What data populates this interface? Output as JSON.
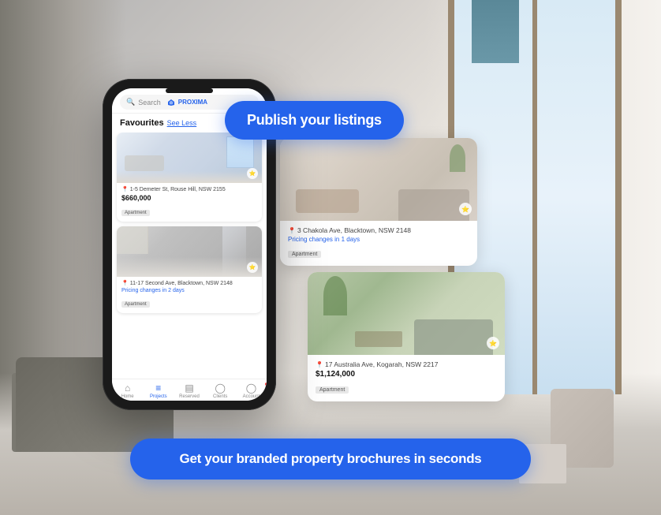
{
  "background": {
    "description": "Modern bright living room interior"
  },
  "publish_button": {
    "label": "Publish your listings"
  },
  "bottom_banner": {
    "label": "Get your branded property brochures in seconds"
  },
  "phone": {
    "search_placeholder": "Search",
    "proxima_brand": "PROXIMA",
    "favourites_title": "Favourites",
    "see_less": "See Less",
    "listings": [
      {
        "address": "1-5 Demeter St, Rouse Hill, NSW 2155",
        "price": "$660,000",
        "price_change": null,
        "badge": "Apartment"
      },
      {
        "address": "11-17 Second Ave, Blacktown, NSW 2148",
        "price": null,
        "price_change": "Pricing changes in 2 days",
        "badge": "Apartment"
      }
    ],
    "nav": [
      {
        "label": "Home",
        "icon": "🏠",
        "active": false
      },
      {
        "label": "Projects",
        "icon": "☰",
        "active": true
      },
      {
        "label": "Reserved",
        "icon": "📋",
        "active": false
      },
      {
        "label": "Clients",
        "icon": "👤",
        "active": false
      },
      {
        "label": "Account",
        "icon": "👤",
        "active": false,
        "has_dot": true
      }
    ]
  },
  "floating_cards": [
    {
      "address": "3 Chakola Ave, Blacktown, NSW 2148",
      "price_change": "Pricing changes in 1 days",
      "price": null,
      "badge": "Apartment"
    },
    {
      "address": "17 Australia Ave, Kogarah, NSW 2217",
      "price": "$1,124,000",
      "price_change": null,
      "badge": "Apartment"
    }
  ]
}
